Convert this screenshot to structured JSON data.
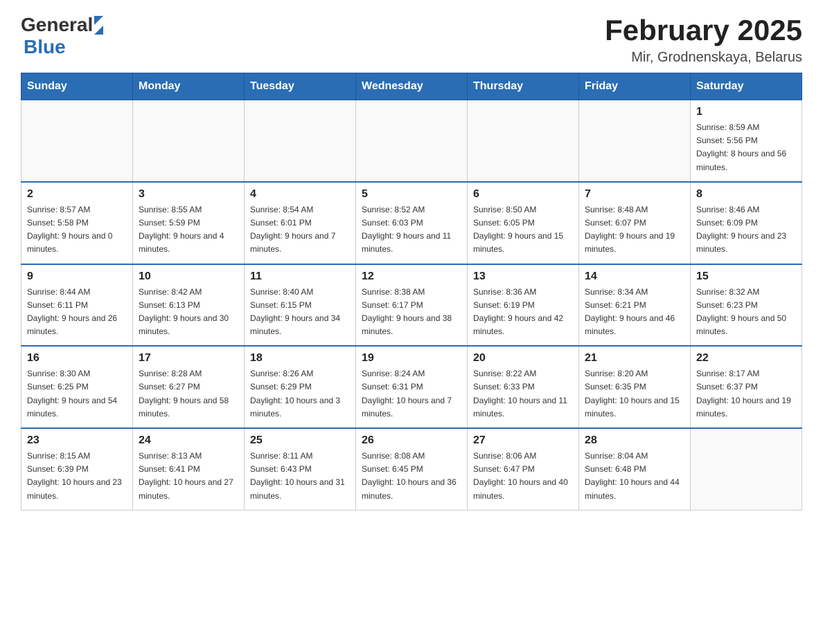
{
  "header": {
    "logo_general": "General",
    "logo_blue": "Blue",
    "month_title": "February 2025",
    "location": "Mir, Grodnenskaya, Belarus"
  },
  "weekdays": [
    "Sunday",
    "Monday",
    "Tuesday",
    "Wednesday",
    "Thursday",
    "Friday",
    "Saturday"
  ],
  "weeks": [
    [
      {
        "day": "",
        "info": ""
      },
      {
        "day": "",
        "info": ""
      },
      {
        "day": "",
        "info": ""
      },
      {
        "day": "",
        "info": ""
      },
      {
        "day": "",
        "info": ""
      },
      {
        "day": "",
        "info": ""
      },
      {
        "day": "1",
        "info": "Sunrise: 8:59 AM\nSunset: 5:56 PM\nDaylight: 8 hours and 56 minutes."
      }
    ],
    [
      {
        "day": "2",
        "info": "Sunrise: 8:57 AM\nSunset: 5:58 PM\nDaylight: 9 hours and 0 minutes."
      },
      {
        "day": "3",
        "info": "Sunrise: 8:55 AM\nSunset: 5:59 PM\nDaylight: 9 hours and 4 minutes."
      },
      {
        "day": "4",
        "info": "Sunrise: 8:54 AM\nSunset: 6:01 PM\nDaylight: 9 hours and 7 minutes."
      },
      {
        "day": "5",
        "info": "Sunrise: 8:52 AM\nSunset: 6:03 PM\nDaylight: 9 hours and 11 minutes."
      },
      {
        "day": "6",
        "info": "Sunrise: 8:50 AM\nSunset: 6:05 PM\nDaylight: 9 hours and 15 minutes."
      },
      {
        "day": "7",
        "info": "Sunrise: 8:48 AM\nSunset: 6:07 PM\nDaylight: 9 hours and 19 minutes."
      },
      {
        "day": "8",
        "info": "Sunrise: 8:46 AM\nSunset: 6:09 PM\nDaylight: 9 hours and 23 minutes."
      }
    ],
    [
      {
        "day": "9",
        "info": "Sunrise: 8:44 AM\nSunset: 6:11 PM\nDaylight: 9 hours and 26 minutes."
      },
      {
        "day": "10",
        "info": "Sunrise: 8:42 AM\nSunset: 6:13 PM\nDaylight: 9 hours and 30 minutes."
      },
      {
        "day": "11",
        "info": "Sunrise: 8:40 AM\nSunset: 6:15 PM\nDaylight: 9 hours and 34 minutes."
      },
      {
        "day": "12",
        "info": "Sunrise: 8:38 AM\nSunset: 6:17 PM\nDaylight: 9 hours and 38 minutes."
      },
      {
        "day": "13",
        "info": "Sunrise: 8:36 AM\nSunset: 6:19 PM\nDaylight: 9 hours and 42 minutes."
      },
      {
        "day": "14",
        "info": "Sunrise: 8:34 AM\nSunset: 6:21 PM\nDaylight: 9 hours and 46 minutes."
      },
      {
        "day": "15",
        "info": "Sunrise: 8:32 AM\nSunset: 6:23 PM\nDaylight: 9 hours and 50 minutes."
      }
    ],
    [
      {
        "day": "16",
        "info": "Sunrise: 8:30 AM\nSunset: 6:25 PM\nDaylight: 9 hours and 54 minutes."
      },
      {
        "day": "17",
        "info": "Sunrise: 8:28 AM\nSunset: 6:27 PM\nDaylight: 9 hours and 58 minutes."
      },
      {
        "day": "18",
        "info": "Sunrise: 8:26 AM\nSunset: 6:29 PM\nDaylight: 10 hours and 3 minutes."
      },
      {
        "day": "19",
        "info": "Sunrise: 8:24 AM\nSunset: 6:31 PM\nDaylight: 10 hours and 7 minutes."
      },
      {
        "day": "20",
        "info": "Sunrise: 8:22 AM\nSunset: 6:33 PM\nDaylight: 10 hours and 11 minutes."
      },
      {
        "day": "21",
        "info": "Sunrise: 8:20 AM\nSunset: 6:35 PM\nDaylight: 10 hours and 15 minutes."
      },
      {
        "day": "22",
        "info": "Sunrise: 8:17 AM\nSunset: 6:37 PM\nDaylight: 10 hours and 19 minutes."
      }
    ],
    [
      {
        "day": "23",
        "info": "Sunrise: 8:15 AM\nSunset: 6:39 PM\nDaylight: 10 hours and 23 minutes."
      },
      {
        "day": "24",
        "info": "Sunrise: 8:13 AM\nSunset: 6:41 PM\nDaylight: 10 hours and 27 minutes."
      },
      {
        "day": "25",
        "info": "Sunrise: 8:11 AM\nSunset: 6:43 PM\nDaylight: 10 hours and 31 minutes."
      },
      {
        "day": "26",
        "info": "Sunrise: 8:08 AM\nSunset: 6:45 PM\nDaylight: 10 hours and 36 minutes."
      },
      {
        "day": "27",
        "info": "Sunrise: 8:06 AM\nSunset: 6:47 PM\nDaylight: 10 hours and 40 minutes."
      },
      {
        "day": "28",
        "info": "Sunrise: 8:04 AM\nSunset: 6:48 PM\nDaylight: 10 hours and 44 minutes."
      },
      {
        "day": "",
        "info": ""
      }
    ]
  ]
}
